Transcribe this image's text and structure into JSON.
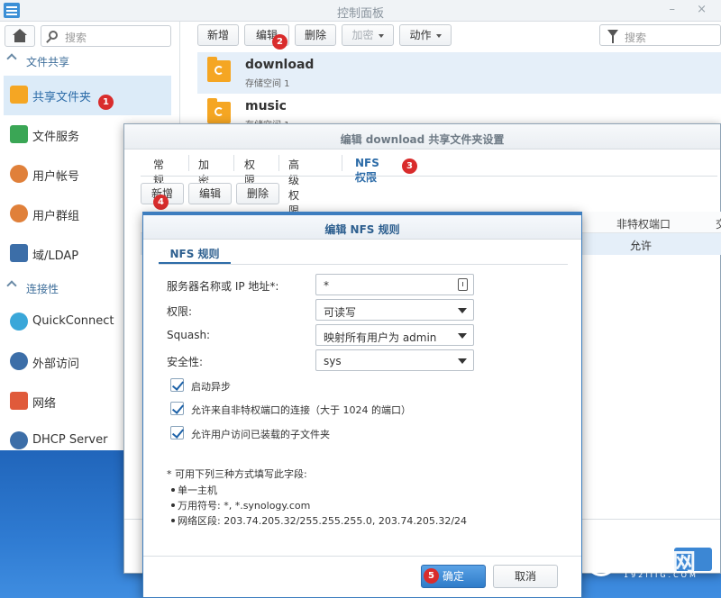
{
  "control_panel": {
    "title": "控制面板",
    "window_controls": "– ×"
  },
  "sidebar": {
    "search_placeholder": "搜索",
    "sections": [
      {
        "label": "文件共享"
      },
      {
        "label": "连接性"
      }
    ],
    "items": [
      {
        "label": "共享文件夹",
        "icon": "shared-folder-icon",
        "color": "#f5a623",
        "active": true
      },
      {
        "label": "文件服务",
        "icon": "file-services-icon",
        "color": "#3aa655"
      },
      {
        "label": "用户帐号",
        "icon": "user-icon",
        "color": "#e0803a"
      },
      {
        "label": "用户群组",
        "icon": "group-icon",
        "color": "#e0803a"
      },
      {
        "label": "域/LDAP",
        "icon": "domain-icon",
        "color": "#3c6ea8"
      },
      {
        "label": "QuickConnect",
        "icon": "quickconnect-icon",
        "color": "#3aa7d9"
      },
      {
        "label": "外部访问",
        "icon": "external-access-icon",
        "color": "#3c6ea8"
      },
      {
        "label": "网络",
        "icon": "network-icon",
        "color": "#e05a3a"
      },
      {
        "label": "DHCP Server",
        "icon": "dhcp-icon",
        "color": "#3c6ea8"
      }
    ]
  },
  "toolbar": {
    "create": "新增",
    "edit": "编辑",
    "delete": "删除",
    "encrypt": "加密",
    "action": "动作",
    "filter_placeholder": "搜索"
  },
  "shares": [
    {
      "name": "download",
      "sub": "存储空间 1"
    },
    {
      "name": "music",
      "sub": "存储空间 1"
    }
  ],
  "edit_window": {
    "title": "编辑 download 共享文件夹设置",
    "tabs": [
      "常规",
      "加密",
      "权限",
      "高级权限",
      "NFS 权限"
    ],
    "buttons": {
      "create": "新增",
      "edit": "编辑",
      "delete": "删除"
    },
    "grid": {
      "col_unprivileged": "非特权端口",
      "col_more": "交",
      "row_unprivileged": "允许"
    }
  },
  "nfs_dialog": {
    "title": "编辑 NFS 规则",
    "tab": "NFS 规则",
    "fields": {
      "host_label": "服务器名称或 IP 地址*:",
      "host_value": "*",
      "privilege_label": "权限:",
      "privilege_value": "可读写",
      "squash_label": "Squash:",
      "squash_value": "映射所有用户为 admin",
      "security_label": "安全性:",
      "security_value": "sys"
    },
    "checks": [
      "启动异步",
      "允许来自非特权端口的连接（大于 1024 的端口）",
      "允许用户访问已装载的子文件夹"
    ],
    "note": "* 可用下列三种方式填写此字段:",
    "bullets": [
      "单一主机",
      "万用符号: *, *.synology.com",
      "网络区段: 203.74.205.32/255.255.255.0, 203.74.205.32/24"
    ],
    "ok": "确定",
    "cancel": "取消"
  },
  "badges": [
    "1",
    "2",
    "3",
    "4",
    "5"
  ],
  "watermark": {
    "text": "设置网",
    "small": "192IIIG.COM"
  }
}
